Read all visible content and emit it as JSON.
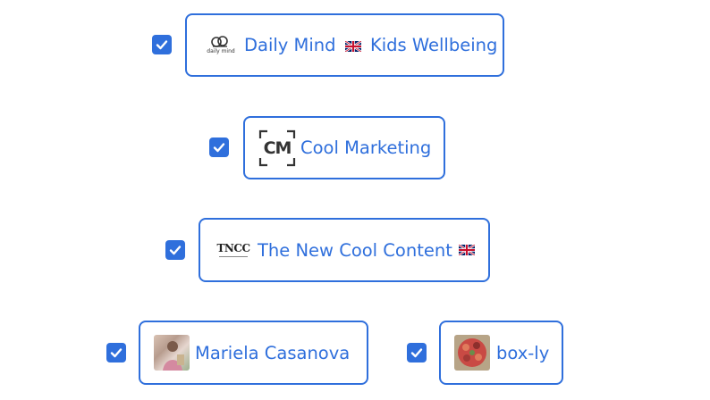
{
  "accent_color": "#2f6fdc",
  "accounts": [
    {
      "name_before_flag": "Daily Mind",
      "name_after_flag": "Kids Wellbeing",
      "checked": true,
      "logo_icon": "daily-mind-logo-icon",
      "logo_text": "daily mind"
    },
    {
      "name": "Cool Marketing",
      "checked": true,
      "logo_icon": "cm-logo-icon",
      "logo_text": "CM"
    },
    {
      "name": "The New Cool Content",
      "checked": true,
      "logo_icon": "tncc-logo-icon",
      "logo_text": "TNCC"
    },
    {
      "name": "Mariela Casanova",
      "checked": true,
      "logo_icon": "profile-photo-icon"
    },
    {
      "name": "box-ly",
      "checked": true,
      "logo_icon": "food-photo-icon"
    }
  ]
}
